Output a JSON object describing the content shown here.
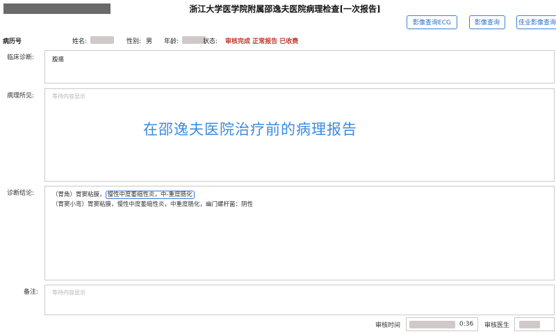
{
  "header": {
    "title": "浙江大学医学院附属邵逸夫医院病理检查[一次报告]",
    "buttons": [
      "影像查询ECG",
      "影像查询",
      "佳业影像查询"
    ]
  },
  "patient_info": {
    "record_label": "病历号",
    "name_label": "姓名:",
    "gender_label": "性别:",
    "gender_value": "男",
    "age_label": "年龄:",
    "status_label": "状态:",
    "status_value": "审核完成 正常报告 已收费"
  },
  "sections": {
    "clinical_diagnosis": {
      "label": "临床诊断:",
      "value": "腹痛"
    },
    "pathology_findings": {
      "label": "病理所见:",
      "placeholder": "等待内容显示"
    },
    "diagnosis_conclusion": {
      "label": "诊断结论:",
      "line1_prefix": "（胃角）胃窦粘膜，",
      "line1_highlight": "慢性中度萎缩性炎，中-重度肠化",
      "line2": "（胃窦小弯）胃窦粘膜，慢性中度萎缩性炎，中重度肠化，幽门螺杆菌：阴性"
    },
    "remarks": {
      "label": "备注:",
      "placeholder": "等待内容显示"
    }
  },
  "overlay_text": "在邵逸夫医院治疗前的病理报告",
  "footer": {
    "review_time_label": "审核时间",
    "review_time_partial": "0:36",
    "reviewer_label": "审核医生"
  },
  "colors": {
    "accent": "#3a8be0",
    "status": "#c0392b",
    "highlight_border": "#2f7ae5"
  }
}
